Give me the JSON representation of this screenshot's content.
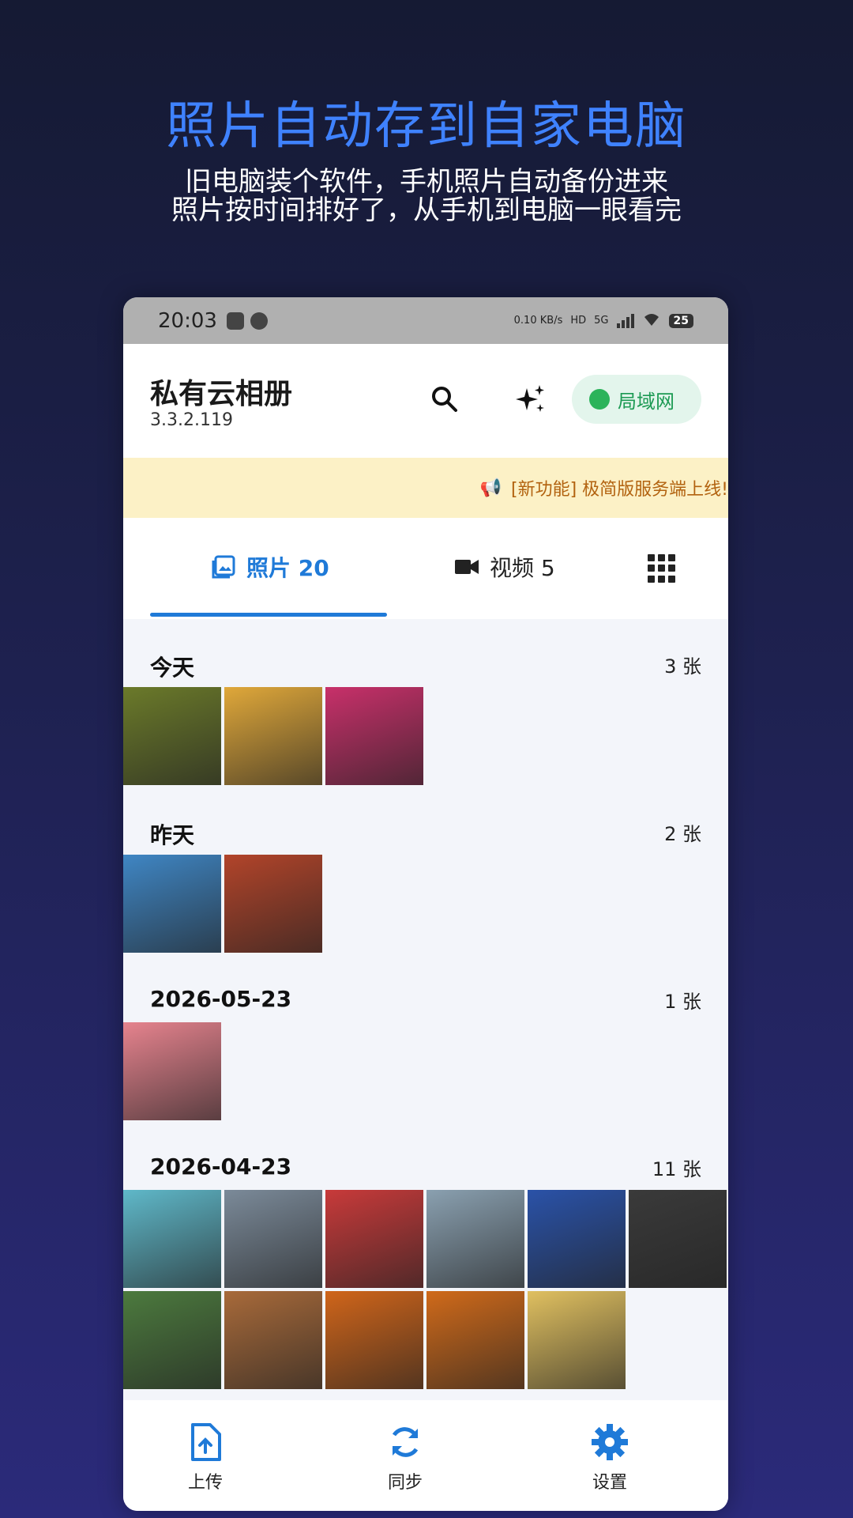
{
  "promo": {
    "headline": "照片自动存到自家电脑",
    "line1": "旧电脑装个软件，手机照片自动备份进来",
    "line2": "照片按时间排好了，从手机到电脑一眼看完"
  },
  "status_bar": {
    "time": "20:03",
    "net_speed_top": "0.10",
    "net_speed_unit": "KB/s",
    "hd_badge": "HD",
    "network": "5G",
    "battery": "25"
  },
  "app": {
    "title": "私有云相册",
    "version": "3.3.2.119",
    "lan_label": "局域网"
  },
  "notice": {
    "text": "[新功能] 极简版服务端上线!"
  },
  "tabs": {
    "photos_label": "照片 20",
    "videos_label": "视频 5"
  },
  "groups": [
    {
      "title": "今天",
      "count": "3 张",
      "thumbs": [
        "#6b7a2a",
        "#e0a83a",
        "#c8306a"
      ]
    },
    {
      "title": "昨天",
      "count": "2 张",
      "thumbs": [
        "#3f86c4",
        "#b2442a"
      ]
    },
    {
      "title": "2026-05-23",
      "count": "1 张",
      "thumbs": [
        "#e6838e"
      ]
    },
    {
      "title": "2026-04-23",
      "count": "11 张",
      "thumbs": [
        "#5fb8c9",
        "#7b8a99",
        "#c83a3a",
        "#8aa0b0",
        "#2a52a8",
        "#3a3a3a",
        "#4c7a3e",
        "#a86a3a",
        "#d0651a",
        "#d06a1a",
        "#e0c060"
      ]
    }
  ],
  "bottom_nav": {
    "upload": "上传",
    "sync": "同步",
    "settings": "设置"
  },
  "colors": {
    "accent": "#1f7ad8",
    "lan_green": "#2bb35a",
    "notice_bg": "#fcf1c6"
  }
}
